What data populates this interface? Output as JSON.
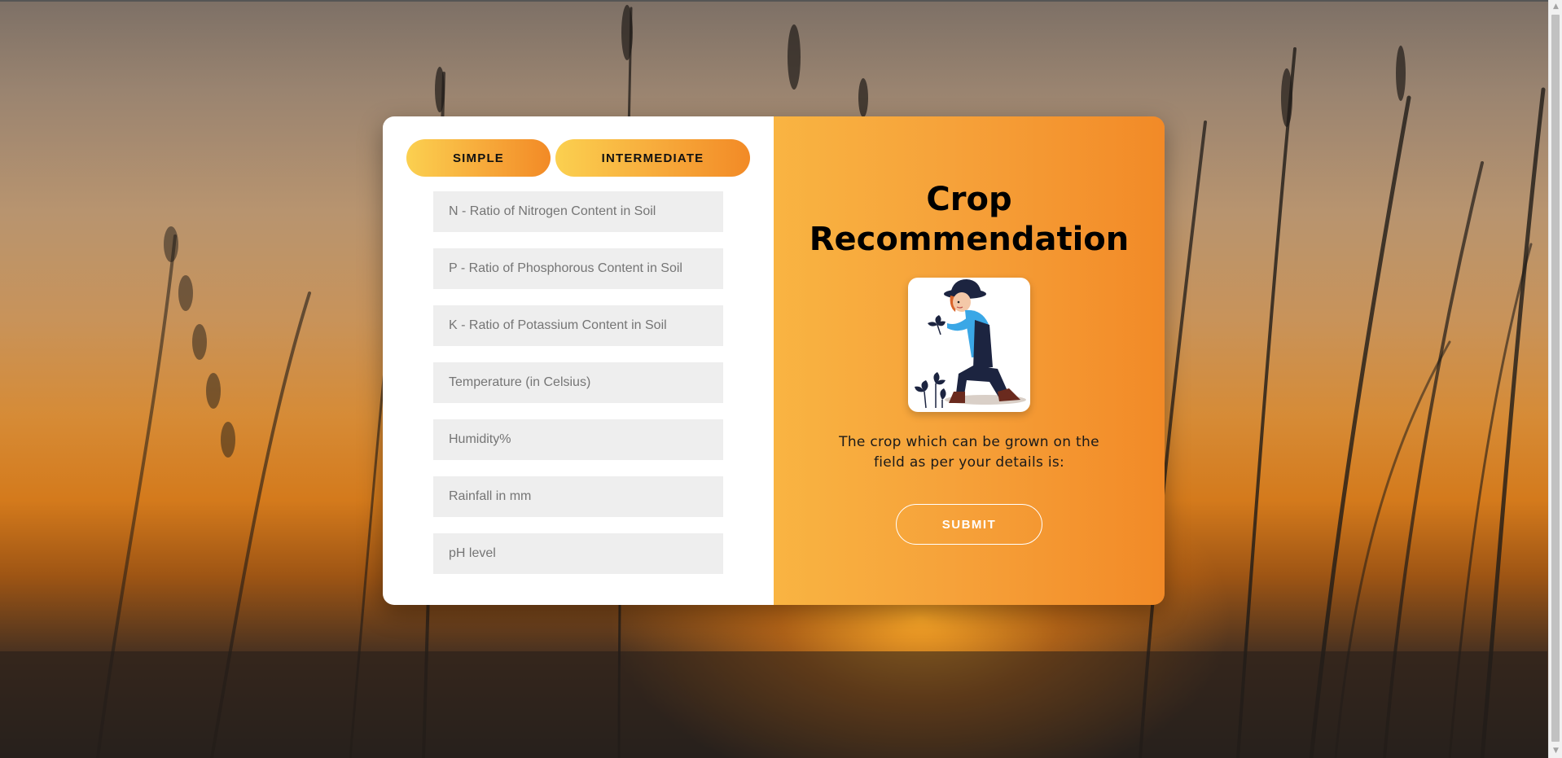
{
  "page": {
    "background_description_colors": [
      "#9a8470",
      "#d68b36",
      "#2b2520"
    ]
  },
  "tabs": {
    "simple_label": "SIMPLE",
    "intermediate_label": "INTERMEDIATE"
  },
  "form": {
    "fields": [
      {
        "name": "nitrogen",
        "placeholder": "N - Ratio of Nitrogen Content in Soil",
        "value": ""
      },
      {
        "name": "phosphorous",
        "placeholder": "P - Ratio of Phosphorous Content in Soil",
        "value": ""
      },
      {
        "name": "potassium",
        "placeholder": "K - Ratio of Potassium Content in Soil",
        "value": ""
      },
      {
        "name": "temperature",
        "placeholder": "Temperature (in Celsius)",
        "value": ""
      },
      {
        "name": "humidity",
        "placeholder": "Humidity%",
        "value": ""
      },
      {
        "name": "rainfall",
        "placeholder": "Rainfall in mm",
        "value": ""
      },
      {
        "name": "ph",
        "placeholder": "pH level",
        "value": ""
      }
    ]
  },
  "result_panel": {
    "title_line1": "Crop",
    "title_line2": "Recommendation",
    "illustration_icon": "farmer-illustration",
    "result_text": "The crop which can be grown on the field as per your details is:",
    "submit_label": "SUBMIT"
  },
  "colors": {
    "accent_start": "#fbd050",
    "accent_end": "#f28a26",
    "field_bg": "#eeeeee"
  }
}
